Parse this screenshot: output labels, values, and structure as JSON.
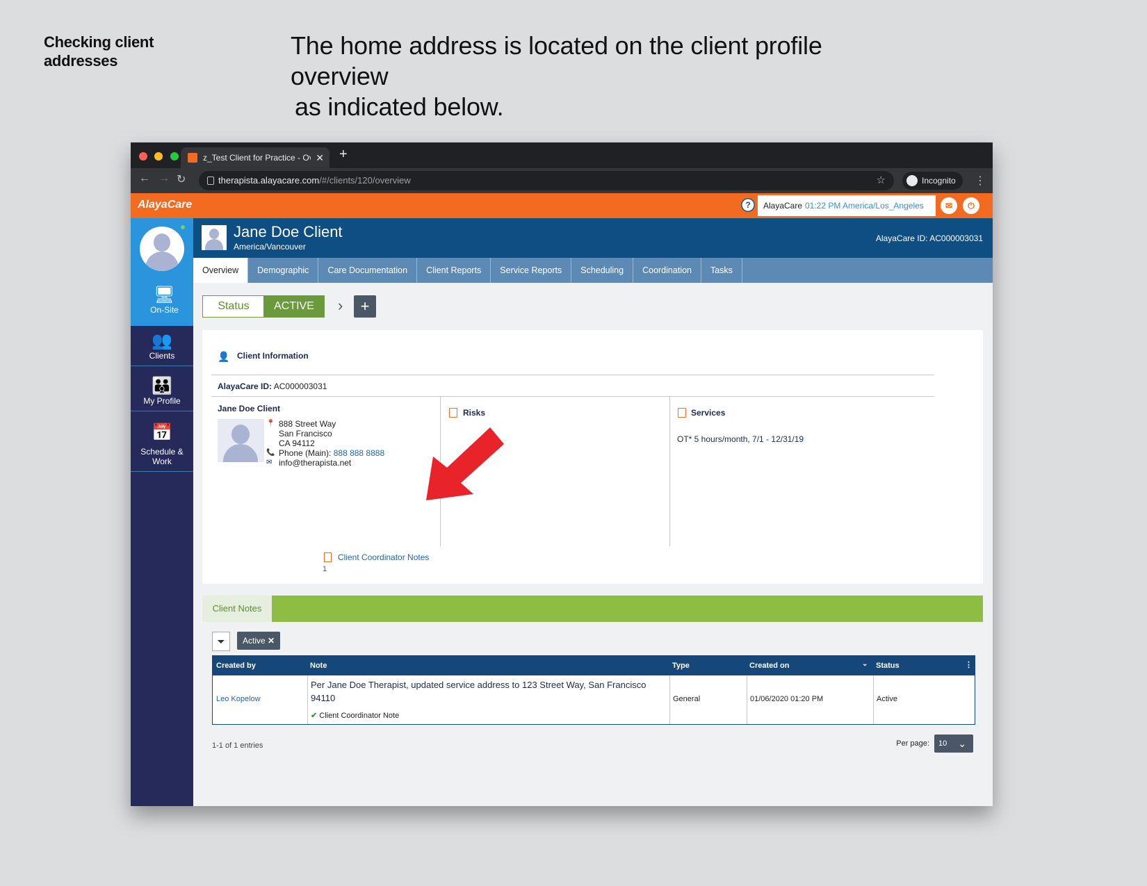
{
  "slide": {
    "side_title": "Checking client addresses",
    "main_line1": "The home address is located on the client profile overview",
    "main_line2": "as indicated below."
  },
  "browser": {
    "tab_title": "z_Test Client for Practice - Ove",
    "tab_close": "✕",
    "new_tab": "+",
    "url_host": "therapista.alayacare.com",
    "url_path": "/#/clients/120/overview",
    "incognito": "Incognito"
  },
  "topbar": {
    "logo": "AlayaCare",
    "help": "?",
    "user_name": "AlayaCare",
    "time": "01:22 PM",
    "timezone": "America/Los_Angeles"
  },
  "sidebar": {
    "items": [
      {
        "label": "On-Site",
        "icon": "monitor-icon"
      },
      {
        "label": "Clients",
        "icon": "clients-icon"
      },
      {
        "label": "My Profile",
        "icon": "profile-icon"
      },
      {
        "label": "Schedule & Work",
        "icon": "calendar-icon"
      }
    ]
  },
  "header": {
    "name": "Jane Doe Client",
    "timezone": "America/Vancouver",
    "alayacare_id": "AlayaCare ID: AC000003031"
  },
  "tabs": [
    "Overview",
    "Demographic",
    "Care Documentation",
    "Client Reports",
    "Service Reports",
    "Scheduling",
    "Coordination",
    "Tasks"
  ],
  "status": {
    "label": "Status",
    "value": "ACTIVE"
  },
  "client_info": {
    "title": "Client Information",
    "id_label": "AlayaCare ID:",
    "id_value": "AC000003031",
    "name": "Jane Doe Client",
    "address1": "888 Street Way",
    "address2": "San Francisco",
    "address3": "CA 94112",
    "phone_label": "Phone (Main):",
    "phone": "888 888 8888",
    "email": "info@therapista.net",
    "risks_title": "Risks",
    "services_title": "Services",
    "service_item": "OT* 5 hours/month, 7/1 - 12/31/19",
    "coord_notes_label": "Client Coordinator Notes",
    "coord_notes_count": "1"
  },
  "notes": {
    "tab_label": "Client Notes",
    "filter_chip": "Active",
    "columns": [
      "Created by",
      "Note",
      "Type",
      "Created on",
      "Status"
    ],
    "rows": [
      {
        "created_by": "Leo Kopelow",
        "note": "Per Jane Doe Therapist, updated service address to 123 Street Way, San Francisco 94110",
        "note_sub": "Client Coordinator Note",
        "type": "General",
        "created_on": "01/06/2020 01:20 PM",
        "status": "Active"
      }
    ],
    "entries_text": "1-1 of 1 entries",
    "per_page_label": "Per page:",
    "per_page_value": "10"
  },
  "colors": {
    "brand_orange": "#f26b21",
    "header_blue": "#0f4e83",
    "sidebar_navy": "#262a5a",
    "active_green": "#6a9a3c",
    "notes_green": "#8dbd43",
    "annotation_red": "#e8232a"
  }
}
